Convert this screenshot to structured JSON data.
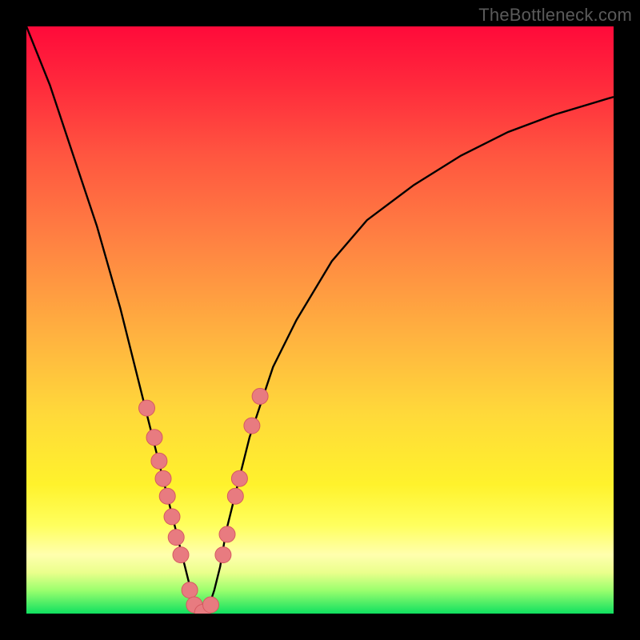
{
  "watermark": "TheBottleneck.com",
  "chart_data": {
    "type": "line",
    "title": "",
    "xlabel": "",
    "ylabel": "",
    "xlim": [
      0,
      100
    ],
    "ylim": [
      0,
      100
    ],
    "series": [
      {
        "name": "bottleneck-curve",
        "x": [
          0,
          4,
          8,
          12,
          16,
          20,
          22,
          24,
          26,
          27,
          28,
          29,
          30,
          31,
          32,
          33,
          34,
          36,
          38,
          42,
          46,
          52,
          58,
          66,
          74,
          82,
          90,
          100
        ],
        "y": [
          100,
          90,
          78,
          66,
          52,
          36,
          28,
          20,
          12,
          8,
          4,
          1,
          0,
          1,
          4,
          8,
          14,
          22,
          30,
          42,
          50,
          60,
          67,
          73,
          78,
          82,
          85,
          88
        ]
      }
    ],
    "scatter": {
      "name": "marker-points",
      "x": [
        20.5,
        21.8,
        22.6,
        23.3,
        24.0,
        24.8,
        25.5,
        26.3,
        27.8,
        28.6,
        30.0,
        31.4,
        33.5,
        34.2,
        35.6,
        36.3,
        38.4,
        39.8
      ],
      "y": [
        35.0,
        30.0,
        26.0,
        23.0,
        20.0,
        16.5,
        13.0,
        10.0,
        4.0,
        1.5,
        0.2,
        1.5,
        10.0,
        13.5,
        20.0,
        23.0,
        32.0,
        37.0
      ]
    },
    "colors": {
      "curve": "#000000",
      "markers_fill": "#e87b80",
      "markers_stroke": "#d65a60",
      "gradient_top": "#ff0a3a",
      "gradient_bottom": "#10e060"
    }
  }
}
